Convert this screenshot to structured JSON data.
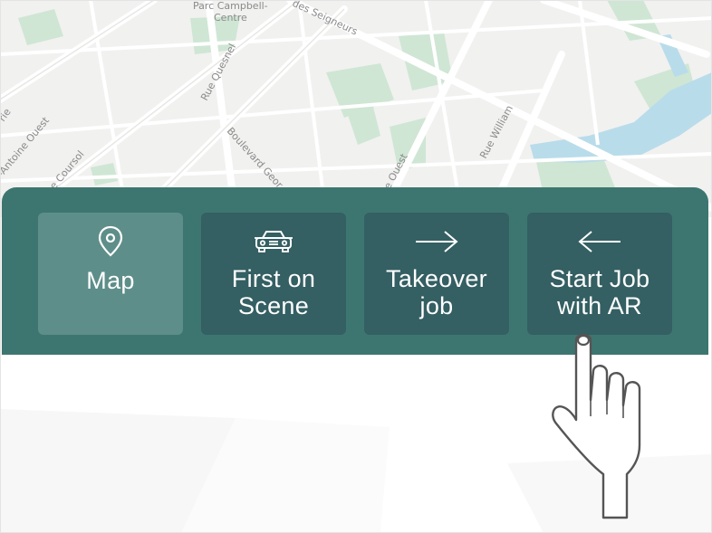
{
  "map": {
    "labels": {
      "park": "Parc Campbell-",
      "park2": "Centre",
      "seigneurs": "des Seigneurs",
      "quesnel": "Rue Quesnel",
      "william": "Rue William",
      "boulevard": "Boulevard Geor",
      "antoine": "-Antoine Ouest",
      "coursol": "e Coursol",
      "ouest": "e Ouest",
      "rie": "rie"
    },
    "colors": {
      "background": "#f1f1f0",
      "park": "#cfe6d4",
      "water": "#b9dcea",
      "road": "#ffffff"
    }
  },
  "menu": {
    "colors": {
      "panel": "#3d7670",
      "tile": "#345f63",
      "active_tile": "#5e8e89"
    },
    "items": [
      {
        "label": "Map",
        "icon": "location-pin-icon",
        "active": true
      },
      {
        "label_line1": "First on",
        "label_line2": "Scene",
        "icon": "car-icon",
        "active": false
      },
      {
        "label_line1": "Takeover",
        "label_line2": "job",
        "icon": "arrow-right-icon",
        "active": false
      },
      {
        "label_line1": "Start Job",
        "label_line2": "with AR",
        "icon": "arrow-left-icon",
        "active": false
      }
    ]
  },
  "overlay": {
    "icon": "pointing-hand-icon"
  }
}
